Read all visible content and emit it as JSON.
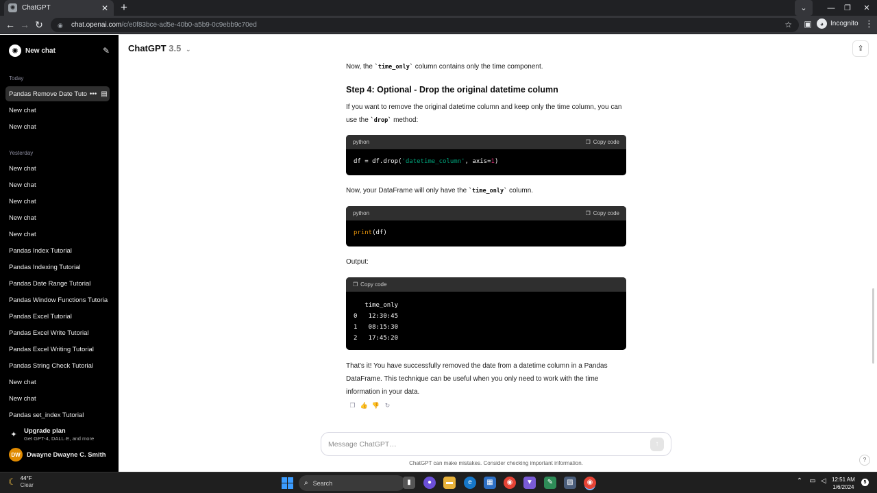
{
  "browser": {
    "tab_title": "ChatGPT",
    "url_host": "chat.openai.com",
    "url_path": "/c/e0f83bce-ad5e-40b0-a5b9-0c9ebb9c70ed",
    "incognito_label": "Incognito"
  },
  "sidebar": {
    "new_chat_label": "New chat",
    "section_today": "Today",
    "section_yesterday": "Yesterday",
    "items": [
      "Pandas Remove Date Tuto",
      "New chat",
      "New chat",
      "New chat",
      "New chat",
      "New chat",
      "New chat",
      "New chat",
      "Pandas Index Tutorial",
      "Pandas Indexing Tutorial",
      "Pandas Date Range Tutorial",
      "Pandas Window Functions Tutoria",
      "Pandas Excel Tutorial",
      "Pandas Excel Write Tutorial",
      "Pandas Excel Writing Tutorial",
      "Pandas String Check Tutorial",
      "New chat",
      "New chat",
      "Pandas set_index Tutorial"
    ],
    "upgrade_title": "Upgrade plan",
    "upgrade_subtitle": "Get GPT-4, DALL·E, and more",
    "user_initials": "DW",
    "user_name": "Dwayne Dwayne C. Smith"
  },
  "header": {
    "model_name": "ChatGPT",
    "model_version": "3.5"
  },
  "message": {
    "p1_before": "Now, the ",
    "p1_code": "`time_only`",
    "p1_after": " column contains only the time component.",
    "step4_heading": "Step 4: Optional - Drop the original datetime column",
    "p2_before": "If you want to remove the original datetime column and keep only the time column, you can use the ",
    "p2_code": "`drop`",
    "p2_after": " method:",
    "code1": {
      "lang": "python",
      "copy_label": "Copy code",
      "t1": "df = df.drop(",
      "t2": "'datetime_column'",
      "t3": ", axis=",
      "t4": "1",
      "t5": ")"
    },
    "p3_before": "Now, your DataFrame will only have the ",
    "p3_code": "`time_only`",
    "p3_after": " column.",
    "code2": {
      "lang": "python",
      "copy_label": "Copy code",
      "t1": "print",
      "t2": "(df)"
    },
    "output_label": "Output:",
    "code3": {
      "copy_label": "Copy code",
      "text": "   time_only\n0   12:30:45\n1   08:15:30\n2   17:45:20"
    },
    "p4": "That's it! You have successfully removed the date from a datetime column in a Pandas DataFrame. This technique can be useful when you only need to work with the time information in your data."
  },
  "composer": {
    "placeholder": "Message ChatGPT…",
    "disclaimer": "ChatGPT can make mistakes. Consider checking important information.",
    "help": "?"
  },
  "taskbar": {
    "temperature": "44°F",
    "condition": "Clear",
    "search_label": "Search",
    "time": "12:51 AM",
    "date": "1/6/2024",
    "notification_count": "5"
  },
  "icons": {
    "accent": "#10a37f",
    "windows_blue": "#3b9cff"
  }
}
